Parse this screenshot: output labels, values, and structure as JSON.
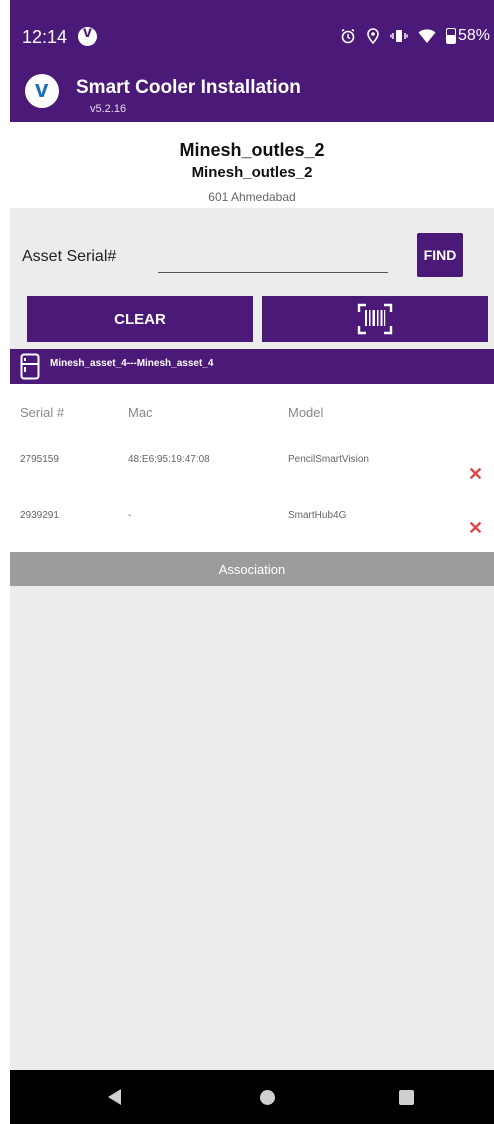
{
  "status_bar": {
    "time": "12:14",
    "battery": "58%",
    "icons": [
      "v-logo-icon",
      "alarm-icon",
      "location-icon",
      "vibrate-icon",
      "wifi-icon",
      "battery-icon"
    ]
  },
  "app": {
    "title": "Smart Cooler Installation",
    "version": "v5.2.16"
  },
  "outlet": {
    "name": "Minesh_outles_2",
    "code": "Minesh_outles_2",
    "location": "601 Ahmedabad"
  },
  "search": {
    "label": "Asset Serial#",
    "value": "",
    "find_label": "FIND",
    "clear_label": "CLEAR"
  },
  "asset": {
    "title": "Minesh_asset_4---Minesh_asset_4"
  },
  "table": {
    "headers": [
      "Serial #",
      "Mac",
      "Model"
    ],
    "rows": [
      {
        "serial": "2795159",
        "mac": "48:E6:95:19:47:08",
        "model": "PencilSmartVision"
      },
      {
        "serial": "2939291",
        "mac": "-",
        "model": "SmartHub4G"
      }
    ]
  },
  "association_label": "Association",
  "colors": {
    "primary": "#4b1a78",
    "delete": "#e04848",
    "section_bar": "#9c9c9c",
    "background": "#ececec"
  }
}
